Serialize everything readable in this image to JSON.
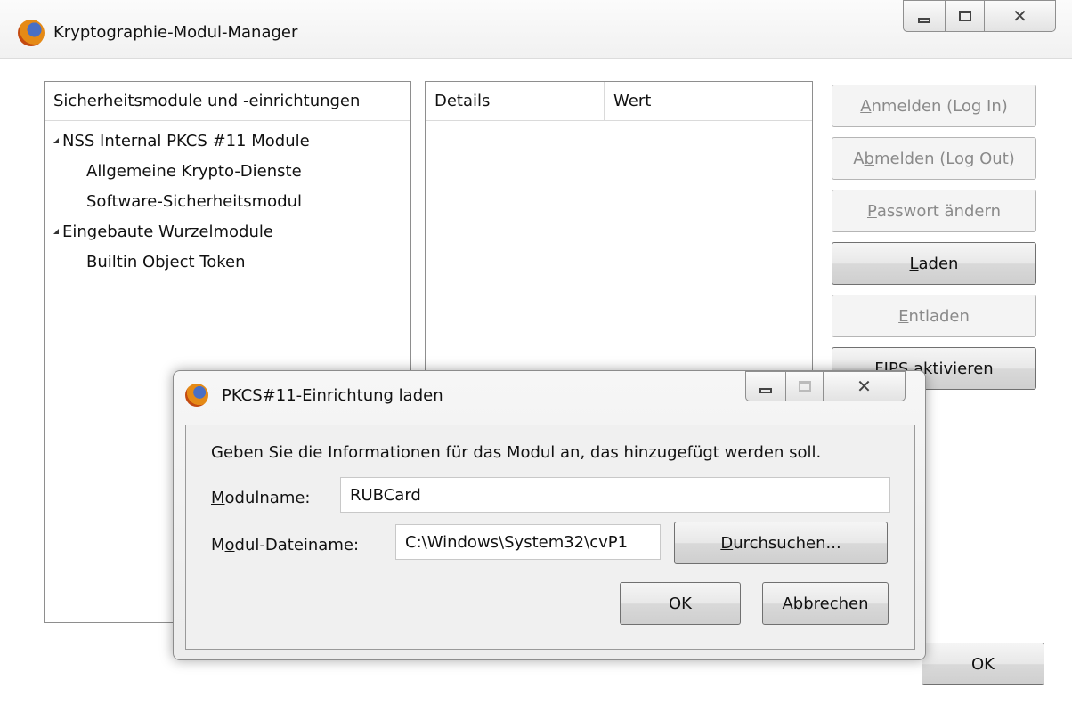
{
  "main_window": {
    "title": "Kryptographie-Modul-Manager",
    "modules_panel": {
      "header": "Sicherheitsmodule und -einrichtungen",
      "tree": [
        {
          "label": "NSS Internal PKCS #11 Module",
          "expanded": true,
          "children": [
            "Allgemeine Krypto-Dienste",
            "Software-Sicherheitsmodul"
          ]
        },
        {
          "label": "Eingebaute Wurzelmodule",
          "expanded": true,
          "children": [
            "Builtin Object Token"
          ]
        }
      ]
    },
    "details_panel": {
      "col_details": "Details",
      "col_value": "Wert"
    },
    "buttons": {
      "login": {
        "pre": "",
        "key": "A",
        "post": "nmelden (Log In)"
      },
      "logout": {
        "pre": "A",
        "key": "b",
        "post": "melden (Log Out)"
      },
      "change_password": {
        "pre": "",
        "key": "P",
        "post": "asswort ändern"
      },
      "load": {
        "pre": "",
        "key": "L",
        "post": "aden"
      },
      "unload": {
        "pre": "",
        "key": "E",
        "post": "ntladen"
      },
      "fips": {
        "label": "FIPS aktivieren"
      },
      "ok": "OK"
    }
  },
  "dialog": {
    "title": "PKCS#11-Einrichtung laden",
    "instruction": "Geben Sie die Informationen für das Modul an, das hinzugefügt werden soll.",
    "module_name": {
      "label_key": "M",
      "label_rest": "odulname:",
      "value": "RUBCard"
    },
    "module_file": {
      "label_pre": "M",
      "label_key": "o",
      "label_rest": "dul-Dateiname:",
      "value": "C:\\Windows\\System32\\cvP1"
    },
    "browse": {
      "key": "D",
      "rest": "urchsuchen..."
    },
    "ok": "OK",
    "cancel": "Abbrechen"
  },
  "colors": {
    "border": "#8e8e8e",
    "disabled_text": "#8a8a8a",
    "dialog_bg": "#f0f0f0"
  }
}
